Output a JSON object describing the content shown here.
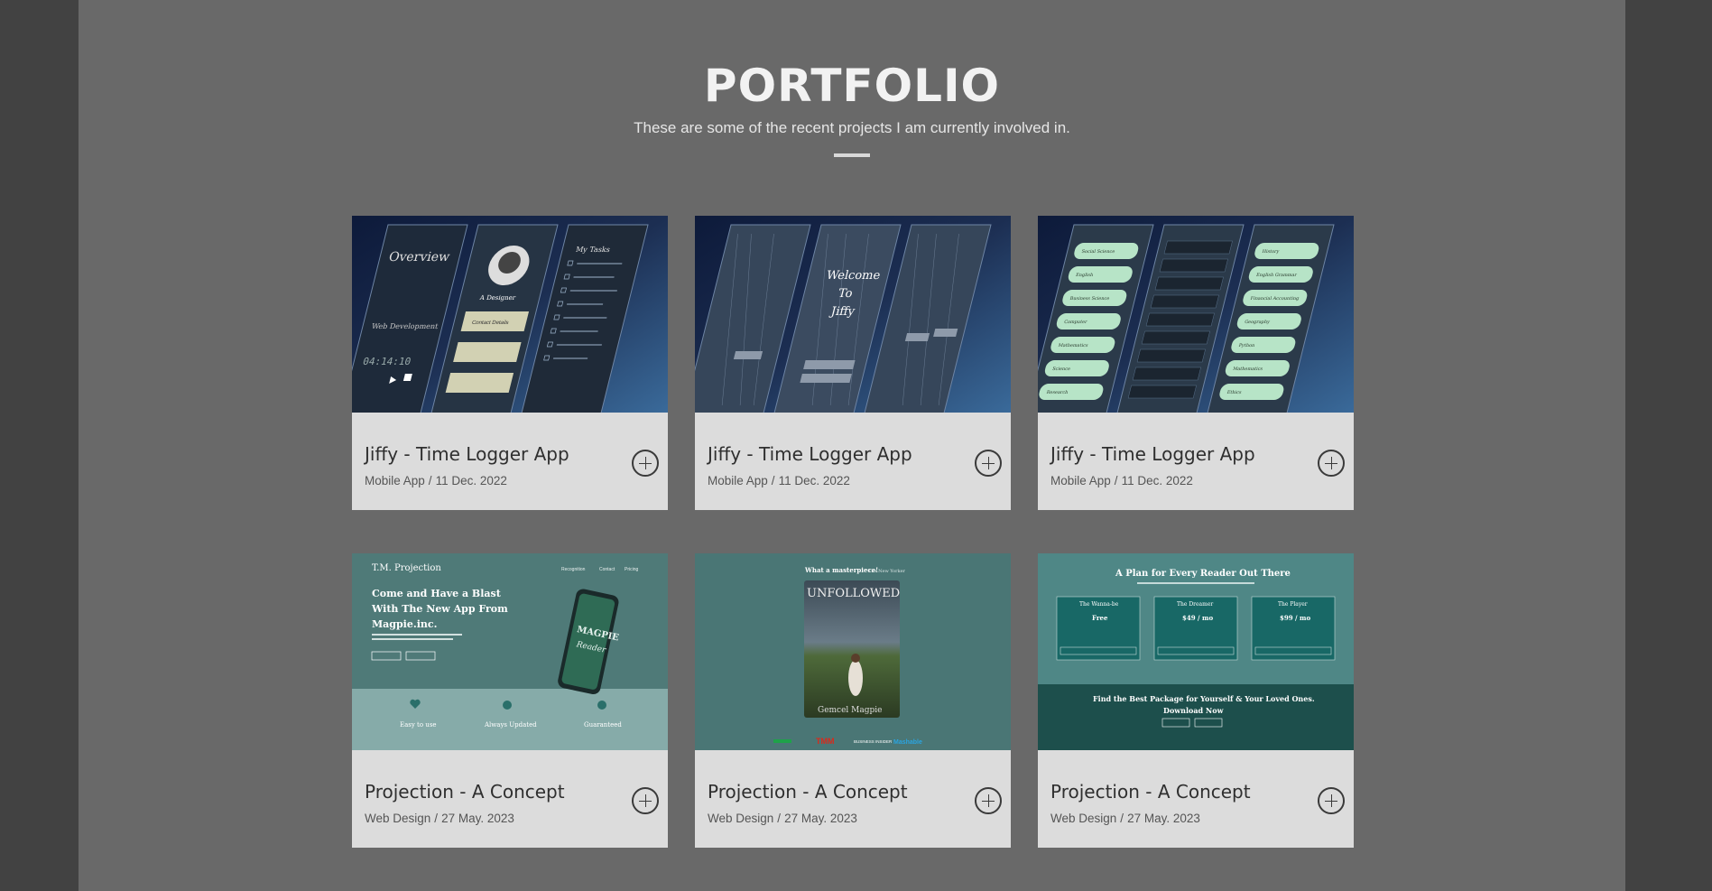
{
  "section": {
    "title": "PORTFOLIO",
    "subtitle": "These are some of the recent projects I am currently involved in."
  },
  "projects": [
    {
      "title": "Jiffy - Time Logger App",
      "category": "Mobile App",
      "date": "11 Dec. 2022",
      "screens": {
        "left": [
          "Overview",
          "Web Development",
          "04:14:10"
        ],
        "middle": [
          "A Designer",
          "Contact Details"
        ],
        "right": [
          "My Tasks"
        ]
      }
    },
    {
      "title": "Jiffy - Time Logger App",
      "category": "Mobile App",
      "date": "11 Dec. 2022",
      "screens": {
        "middle": [
          "Welcome",
          "To",
          "Jiffy"
        ]
      }
    },
    {
      "title": "Jiffy - Time Logger App",
      "category": "Mobile App",
      "date": "11 Dec. 2022",
      "screens": {
        "left": [
          "Social Science",
          "English",
          "Business Science",
          "Computer",
          "Mathematics",
          "Science",
          "Research"
        ],
        "right": [
          "History",
          "English Grammar",
          "Financial Accounting",
          "Geography",
          "Python",
          "Mathematics",
          "Ethics"
        ]
      }
    },
    {
      "title": "Projection - A Concept",
      "category": "Web Design",
      "date": "27 May. 2023",
      "preview": {
        "brand": "T.M. Projection",
        "nav": [
          "Recognition",
          "Contact",
          "Pricing"
        ],
        "headline_1": "Come and Have a Blast",
        "headline_2": "With The New App From",
        "headline_3": "Magpie.inc.",
        "phone_text_1": "MAGPIE",
        "phone_text_2": "Reader",
        "features": [
          "Easy to use",
          "Always Updated",
          "Guaranteed"
        ]
      }
    },
    {
      "title": "Projection - A Concept",
      "category": "Web Design",
      "date": "27 May. 2023",
      "preview": {
        "quote": "What a masterpiece!",
        "quote_source": "The New Yorker",
        "book_title": "UNFOLLOWED",
        "book_author": "Gemcel Magpie",
        "logos": [
          "TMM",
          "BUSINESS INSIDER",
          "Mashable"
        ]
      }
    },
    {
      "title": "Projection - A Concept",
      "category": "Web Design",
      "date": "27 May. 2023",
      "preview": {
        "heading": "A Plan for Every Reader Out There",
        "plans": [
          {
            "name": "The Wanna-be",
            "price": "Free"
          },
          {
            "name": "The Dreamer",
            "price": "$49 / mo"
          },
          {
            "name": "The Player",
            "price": "$99 / mo"
          }
        ],
        "cta_1": "Find the Best Package for Yourself & Your Loved Ones.",
        "cta_2": "Download Now"
      }
    }
  ]
}
